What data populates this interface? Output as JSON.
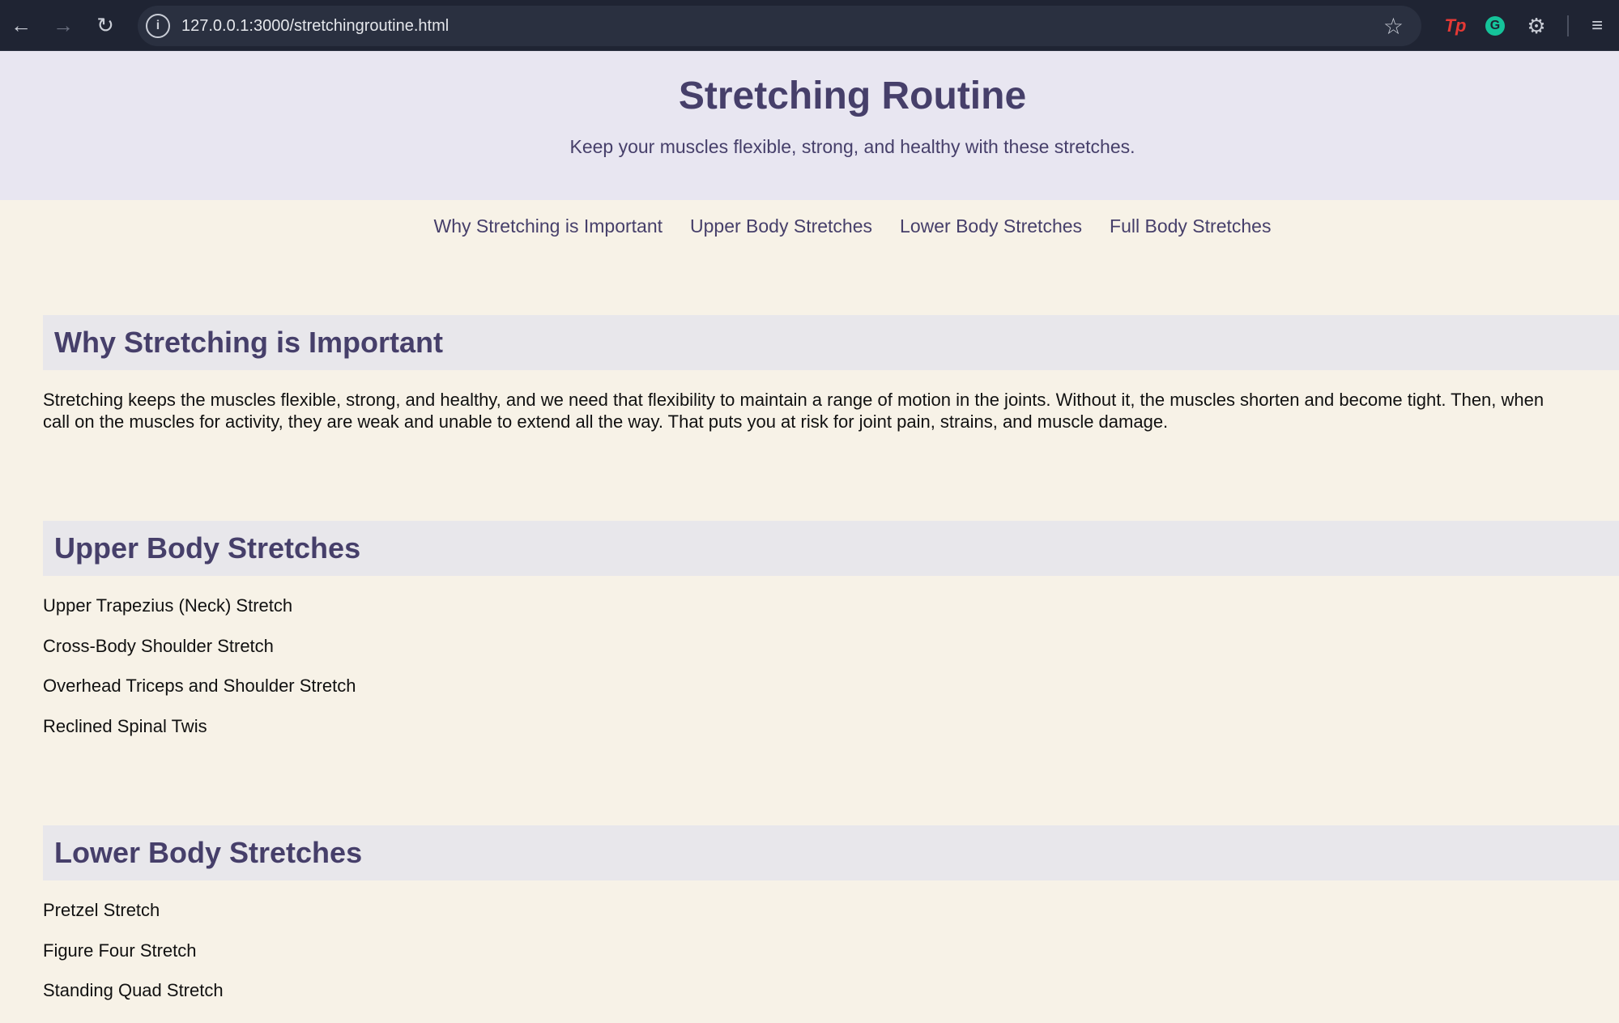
{
  "browser": {
    "url": "127.0.0.1:3000/stretchingroutine.html",
    "back_icon": "arrow-left-icon",
    "forward_icon": "arrow-right-icon",
    "reload_icon": "reload-icon",
    "info_icon": "info-icon",
    "bookmark_icon": "star-icon",
    "extensions": [
      "tp-extension-icon",
      "grammarly-icon",
      "puzzle-icon",
      "tab-search-icon"
    ]
  },
  "header": {
    "title": "Stretching Routine",
    "tagline": "Keep your muscles flexible, strong, and healthy with these stretches."
  },
  "nav": {
    "items": [
      {
        "label": "Why Stretching is Important"
      },
      {
        "label": "Upper Body Stretches"
      },
      {
        "label": "Lower Body Stretches"
      },
      {
        "label": "Full Body Stretches"
      }
    ]
  },
  "sections": {
    "why": {
      "heading": "Why Stretching is Important",
      "line1": "Stretching keeps the muscles flexible, strong, and healthy, and we need that flexibility to maintain a range of motion in the joints. Without it, the muscles shorten and become tight. Then, when",
      "line2": "call on the muscles for activity, they are weak and unable to extend all the way. That puts you at risk for joint pain, strains, and muscle damage."
    },
    "upper": {
      "heading": "Upper Body Stretches",
      "items": [
        "Upper Trapezius (Neck) Stretch",
        "Cross-Body Shoulder Stretch",
        "Overhead Triceps and Shoulder Stretch",
        "Reclined Spinal Twis"
      ]
    },
    "lower": {
      "heading": "Lower Body Stretches",
      "items": [
        "Pretzel Stretch",
        "Figure Four Stretch",
        "Standing Quad Stretch"
      ]
    }
  },
  "colors": {
    "accent": "#463f6a",
    "header_bg": "#e8e6f1",
    "page_bg": "#f7f2e7",
    "section_head_bg": "#e8e7eb",
    "chrome_bg": "#1f2433"
  }
}
